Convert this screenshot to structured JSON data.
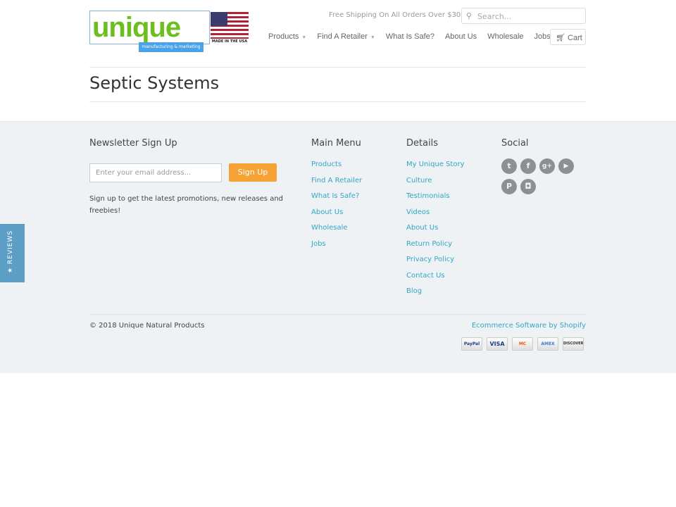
{
  "header": {
    "logo_text": "unique",
    "logo_tagline": "manufacturing & marketing",
    "logo_badge": "MADE IN THE USA",
    "shipping_notice": "Free Shipping On All Orders Over $30",
    "search_placeholder": "Search...",
    "cart_label": "Cart",
    "nav": [
      {
        "label": "Products",
        "dropdown": true
      },
      {
        "label": "Find A Retailer",
        "dropdown": true
      },
      {
        "label": "What Is Safe?"
      },
      {
        "label": "About Us"
      },
      {
        "label": "Wholesale"
      },
      {
        "label": "Jobs"
      }
    ]
  },
  "page": {
    "title": "Septic Systems"
  },
  "footer": {
    "newsletter": {
      "heading": "Newsletter Sign Up",
      "placeholder": "Enter your email address...",
      "button": "Sign Up",
      "description": "Sign up to get the latest promotions, new releases and freebies!"
    },
    "main_menu": {
      "heading": "Main Menu",
      "items": [
        "Products",
        "Find A Retailer",
        "What Is Safe?",
        "About Us",
        "Wholesale",
        "Jobs"
      ]
    },
    "details": {
      "heading": "Details",
      "items": [
        "My Unique Story",
        "Culture",
        "Testimonials",
        "Videos",
        "About Us",
        "Return Policy",
        "Privacy Policy",
        "Contact Us",
        "Blog"
      ]
    },
    "social": {
      "heading": "Social",
      "icons": [
        {
          "name": "twitter-icon",
          "glyph": "t"
        },
        {
          "name": "facebook-icon",
          "glyph": "f"
        },
        {
          "name": "google-plus-icon",
          "glyph": "g+"
        },
        {
          "name": "youtube-icon",
          "glyph": "▶"
        },
        {
          "name": "pinterest-icon",
          "glyph": "P"
        },
        {
          "name": "instagram-icon",
          "glyph": "◘"
        }
      ]
    },
    "copyright": "© 2018 Unique Natural Products",
    "shopify": "Ecommerce Software by Shopify",
    "payments": [
      "PayPal",
      "VISA",
      "MC",
      "AMEX",
      "DISCOVER"
    ]
  },
  "reviews_tab": "★ REVIEWS",
  "colors": {
    "accent": "#f7a234",
    "link": "#33a6c4",
    "footer_bg": "#eef2f5",
    "logo_green": "#6cbf1f"
  }
}
